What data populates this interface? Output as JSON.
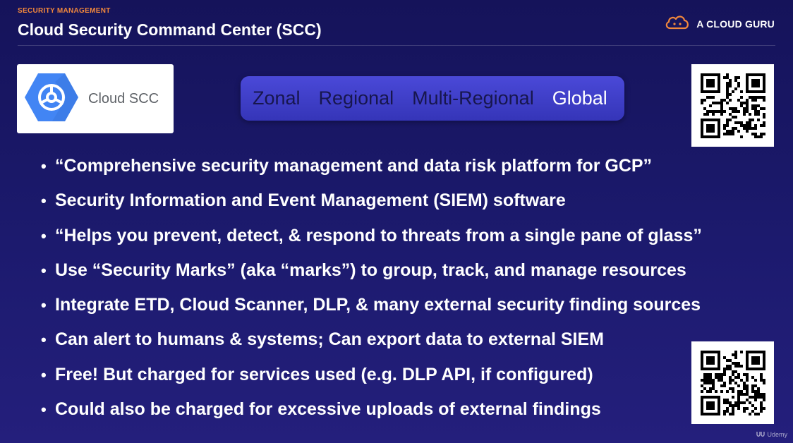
{
  "header": {
    "kicker": "SECURITY MANAGEMENT",
    "title": "Cloud Security Command Center (SCC)",
    "brand": "A CLOUD GURU"
  },
  "logo_card": {
    "label": "Cloud SCC",
    "icon": "cloud-scc-hexagon-icon"
  },
  "scope_pill": {
    "items": [
      "Zonal",
      "Regional",
      "Multi-Regional",
      "Global"
    ],
    "active": "Global"
  },
  "bullets": [
    "“Comprehensive security management and data risk platform for GCP”",
    "Security Information and Event Management (SIEM) software",
    "“Helps you prevent, detect, & respond to threats from a single pane of glass”",
    "Use “Security Marks” (aka “marks”) to group, track, and manage resources",
    "Integrate ETD, Cloud Scanner, DLP, & many external security finding sources",
    "Can alert to humans & systems; Can export data to external SIEM",
    "Free!  But charged for services used (e.g. DLP API, if configured)",
    "Could also be charged for excessive uploads of external findings"
  ],
  "watermark": "Udemy",
  "colors": {
    "accent_orange": "#f2883c",
    "pill_blue": "#3f3ec8",
    "gcp_blue": "#4285f4",
    "background": "#1c1a6e"
  }
}
